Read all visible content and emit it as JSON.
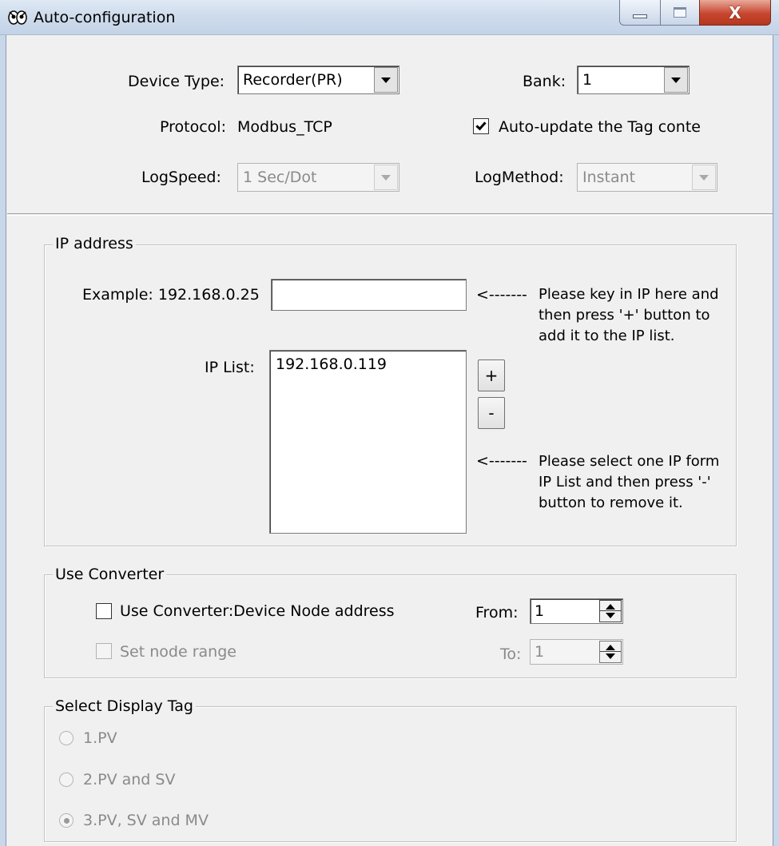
{
  "window": {
    "title": "Auto-configuration",
    "close_glyph": "X",
    "icon": "app-icon"
  },
  "top": {
    "device_type": {
      "label": "Device Type:",
      "value": "Recorder(PR)"
    },
    "bank": {
      "label": "Bank:",
      "value": "1"
    },
    "protocol": {
      "label": "Protocol:",
      "value": "Modbus_TCP"
    },
    "auto_update": {
      "label": "Auto-update the Tag conte",
      "checked": true
    },
    "log_speed": {
      "label": "LogSpeed:",
      "value": "1 Sec/Dot",
      "enabled": false
    },
    "log_method": {
      "label": "LogMethod:",
      "value": "Instant",
      "enabled": false
    }
  },
  "ip_group": {
    "title": "IP address",
    "example_label": "Example: 192.168.0.25",
    "ip_input_value": "",
    "arrow1": "<-------",
    "note1": [
      "Please key in IP here and",
      "then press '+' button to",
      "add it to the IP list."
    ],
    "list_label": "IP List:",
    "list_items": [
      "192.168.0.119"
    ],
    "add_label": "+",
    "remove_label": "-",
    "arrow2": "<-------",
    "note2": [
      "Please select one IP form",
      "IP List and then press '-'",
      "button to remove it."
    ]
  },
  "converter": {
    "title": "Use Converter",
    "use_label": "Use Converter:Device Node address",
    "use_checked": false,
    "range_label": "Set node range",
    "range_enabled": false,
    "from_label": "From:",
    "from_value": "1",
    "to_label": "To:",
    "to_value": "1"
  },
  "display_tag": {
    "title": "Select Display Tag",
    "options": [
      "1.PV",
      "2.PV and SV",
      "3.PV, SV and MV"
    ],
    "selected_index": 2,
    "enabled": false
  },
  "colors": {
    "close_button": "#c7462f",
    "titlebar": "#cfdcec",
    "disabled_text": "#8a8a8a"
  }
}
